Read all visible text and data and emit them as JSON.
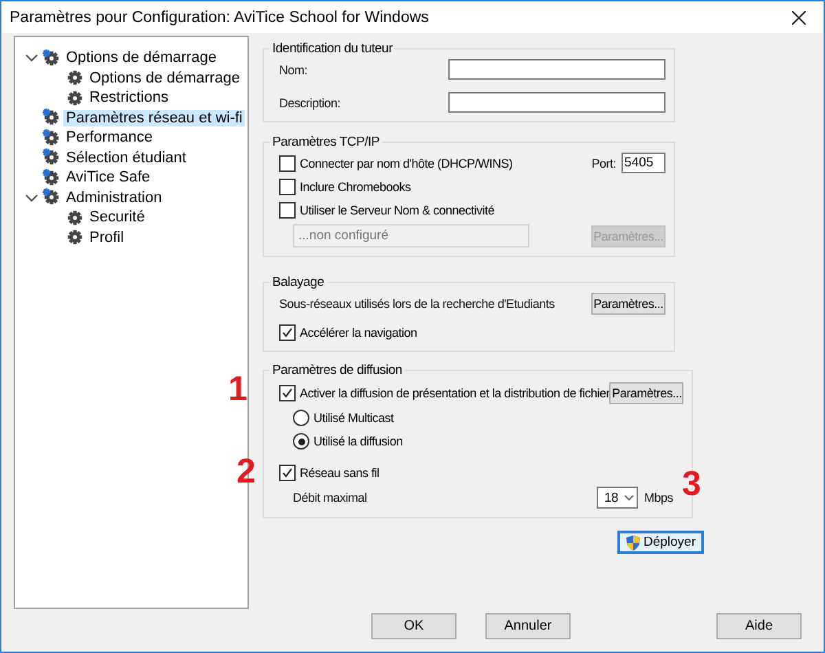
{
  "window": {
    "title": "Paramètres pour Configuration: AviTice School for Windows"
  },
  "tree": [
    {
      "label": "Options de démarrage",
      "selected": false,
      "expanded": true,
      "children": [
        {
          "label": "Options de démarrage",
          "selected": false
        },
        {
          "label": "Restrictions",
          "selected": false
        }
      ]
    },
    {
      "label": "Paramètres réseau et wi-fi",
      "selected": true
    },
    {
      "label": "Performance",
      "selected": false
    },
    {
      "label": "Sélection étudiant",
      "selected": false
    },
    {
      "label": "AviTice Safe",
      "selected": false
    },
    {
      "label": "Administration",
      "selected": false,
      "expanded": true,
      "children": [
        {
          "label": "Securité",
          "selected": false
        },
        {
          "label": "Profil",
          "selected": false
        }
      ]
    }
  ],
  "tutor": {
    "title": "Identification du tuteur",
    "fields": [
      {
        "label": "Nom:"
      },
      {
        "label": "Description:"
      }
    ]
  },
  "tcp": {
    "title": "Paramètres TCP/IP",
    "options": [
      {
        "label": "Connecter par nom d'hôte (DHCP/WINS)",
        "checked": false
      },
      {
        "label": "Inclure Chromebooks",
        "checked": false
      },
      {
        "label": "Utiliser le Serveur Nom & connectivité",
        "checked": false
      }
    ],
    "port": {
      "label": "Port:",
      "value": "5405"
    },
    "server": {
      "placeholder": "...non configuré",
      "disabled": true
    },
    "button": {
      "label": "Paramètres...",
      "disabled": true
    }
  },
  "scan": {
    "title": "Balayage",
    "description": "Sous-réseaux utilisés lors de la recherche d'Etudiants",
    "button": {
      "label": "Paramètres...",
      "disabled": false
    },
    "option": {
      "label": "Accélérer la navigation",
      "checked": true
    }
  },
  "broadcast": {
    "title": "Paramètres de diffusion",
    "enable": {
      "label": "Activer la diffusion de présentation et la distribution de fichier",
      "checked": true
    },
    "button": {
      "label": "Paramètres...",
      "disabled": false
    },
    "modes": [
      {
        "label": "Utilisé Multicast",
        "selected": false
      },
      {
        "label": "Utilisé la diffusion",
        "selected": true
      }
    ],
    "wireless": {
      "label": "Réseau sans fil",
      "checked": true
    },
    "rate": {
      "label": "Débit maximal",
      "value": "18",
      "unit": "Mbps"
    }
  },
  "deploy": {
    "label": "Déployer"
  },
  "footer": {
    "buttons": [
      "OK",
      "Annuler"
    ],
    "help": "Aide"
  },
  "annotations": [
    "1",
    "2",
    "3"
  ]
}
